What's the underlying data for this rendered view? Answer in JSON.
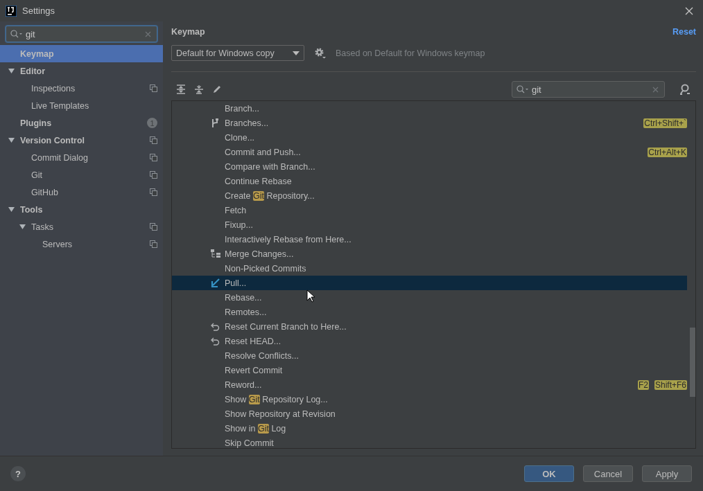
{
  "window": {
    "title": "Settings"
  },
  "sidebar": {
    "search": {
      "value": "git"
    },
    "items": [
      {
        "label": "Keymap",
        "selected": true
      },
      {
        "label": "Editor",
        "selected": false,
        "expanded": true,
        "children": [
          {
            "label": "Inspections",
            "selected": false,
            "project_icon": true
          },
          {
            "label": "Live Templates",
            "selected": false
          }
        ]
      },
      {
        "label": "Plugins",
        "selected": false,
        "badge": "1"
      },
      {
        "label": "Version Control",
        "selected": false,
        "expanded": true,
        "project_icon": true,
        "children": [
          {
            "label": "Commit Dialog",
            "selected": false,
            "project_icon": true
          },
          {
            "label": "Git",
            "selected": false,
            "project_icon": true
          },
          {
            "label": "GitHub",
            "selected": false,
            "project_icon": true
          }
        ]
      },
      {
        "label": "Tools",
        "selected": false,
        "expanded": true,
        "children": [
          {
            "label": "Tasks",
            "selected": false,
            "expanded": true,
            "project_icon": true,
            "children": [
              {
                "label": "Servers",
                "selected": false,
                "project_icon": true
              }
            ]
          }
        ]
      }
    ]
  },
  "page": {
    "title": "Keymap",
    "reset": "Reset",
    "keymap_select": "Default for Windows copy",
    "based_on": "Based on Default for Windows keymap",
    "search": {
      "value": "git"
    }
  },
  "actions": [
    {
      "parts": [
        {
          "text": "Branch..."
        }
      ],
      "selected": false
    },
    {
      "parts": [
        {
          "text": "Branches..."
        }
      ],
      "kind": "branch",
      "shortcuts": [
        "Ctrl+Shift+`"
      ],
      "selected": false
    },
    {
      "parts": [
        {
          "text": "Clone..."
        }
      ],
      "selected": false
    },
    {
      "parts": [
        {
          "text": "Commit and Push..."
        }
      ],
      "shortcuts": [
        "Ctrl+Alt+K"
      ],
      "selected": false
    },
    {
      "parts": [
        {
          "text": "Compare with Branch..."
        }
      ],
      "selected": false
    },
    {
      "parts": [
        {
          "text": "Continue Rebase"
        }
      ],
      "selected": false
    },
    {
      "parts": [
        {
          "text": "Create "
        },
        {
          "text": "Git",
          "match": true
        },
        {
          "text": " Repository..."
        }
      ],
      "selected": false
    },
    {
      "parts": [
        {
          "text": "Fetch"
        }
      ],
      "selected": false
    },
    {
      "parts": [
        {
          "text": "Fixup..."
        }
      ],
      "selected": false
    },
    {
      "parts": [
        {
          "text": "Interactively Rebase from Here..."
        }
      ],
      "selected": false
    },
    {
      "parts": [
        {
          "text": "Merge Changes..."
        }
      ],
      "kind": "merge",
      "selected": false
    },
    {
      "parts": [
        {
          "text": "Non-Picked Commits"
        }
      ],
      "selected": false
    },
    {
      "parts": [
        {
          "text": "Pull..."
        }
      ],
      "kind": "pull",
      "selected": true
    },
    {
      "parts": [
        {
          "text": "Rebase..."
        }
      ],
      "selected": false
    },
    {
      "parts": [
        {
          "text": "Remotes..."
        }
      ],
      "selected": false
    },
    {
      "parts": [
        {
          "text": "Reset Current Branch to Here..."
        }
      ],
      "kind": "undo",
      "selected": false
    },
    {
      "parts": [
        {
          "text": "Reset HEAD..."
        }
      ],
      "kind": "undo",
      "selected": false
    },
    {
      "parts": [
        {
          "text": "Resolve Conflicts..."
        }
      ],
      "selected": false
    },
    {
      "parts": [
        {
          "text": "Revert Commit"
        }
      ],
      "selected": false
    },
    {
      "parts": [
        {
          "text": "Reword..."
        }
      ],
      "shortcuts": [
        "F2",
        "Shift+F6"
      ],
      "selected": false
    },
    {
      "parts": [
        {
          "text": "Show "
        },
        {
          "text": "Git",
          "match": true
        },
        {
          "text": " Repository Log..."
        }
      ],
      "selected": false
    },
    {
      "parts": [
        {
          "text": "Show Repository at Revision"
        }
      ],
      "selected": false
    },
    {
      "parts": [
        {
          "text": "Show in "
        },
        {
          "text": "Git",
          "match": true
        },
        {
          "text": " Log"
        }
      ],
      "selected": false
    },
    {
      "parts": [
        {
          "text": "Skip Commit"
        }
      ],
      "selected": false
    }
  ],
  "help": "?",
  "buttons": [
    {
      "label": "OK",
      "kind": "primary"
    },
    {
      "label": "Cancel",
      "kind": "normal"
    },
    {
      "label": "Apply",
      "kind": "normal"
    }
  ]
}
